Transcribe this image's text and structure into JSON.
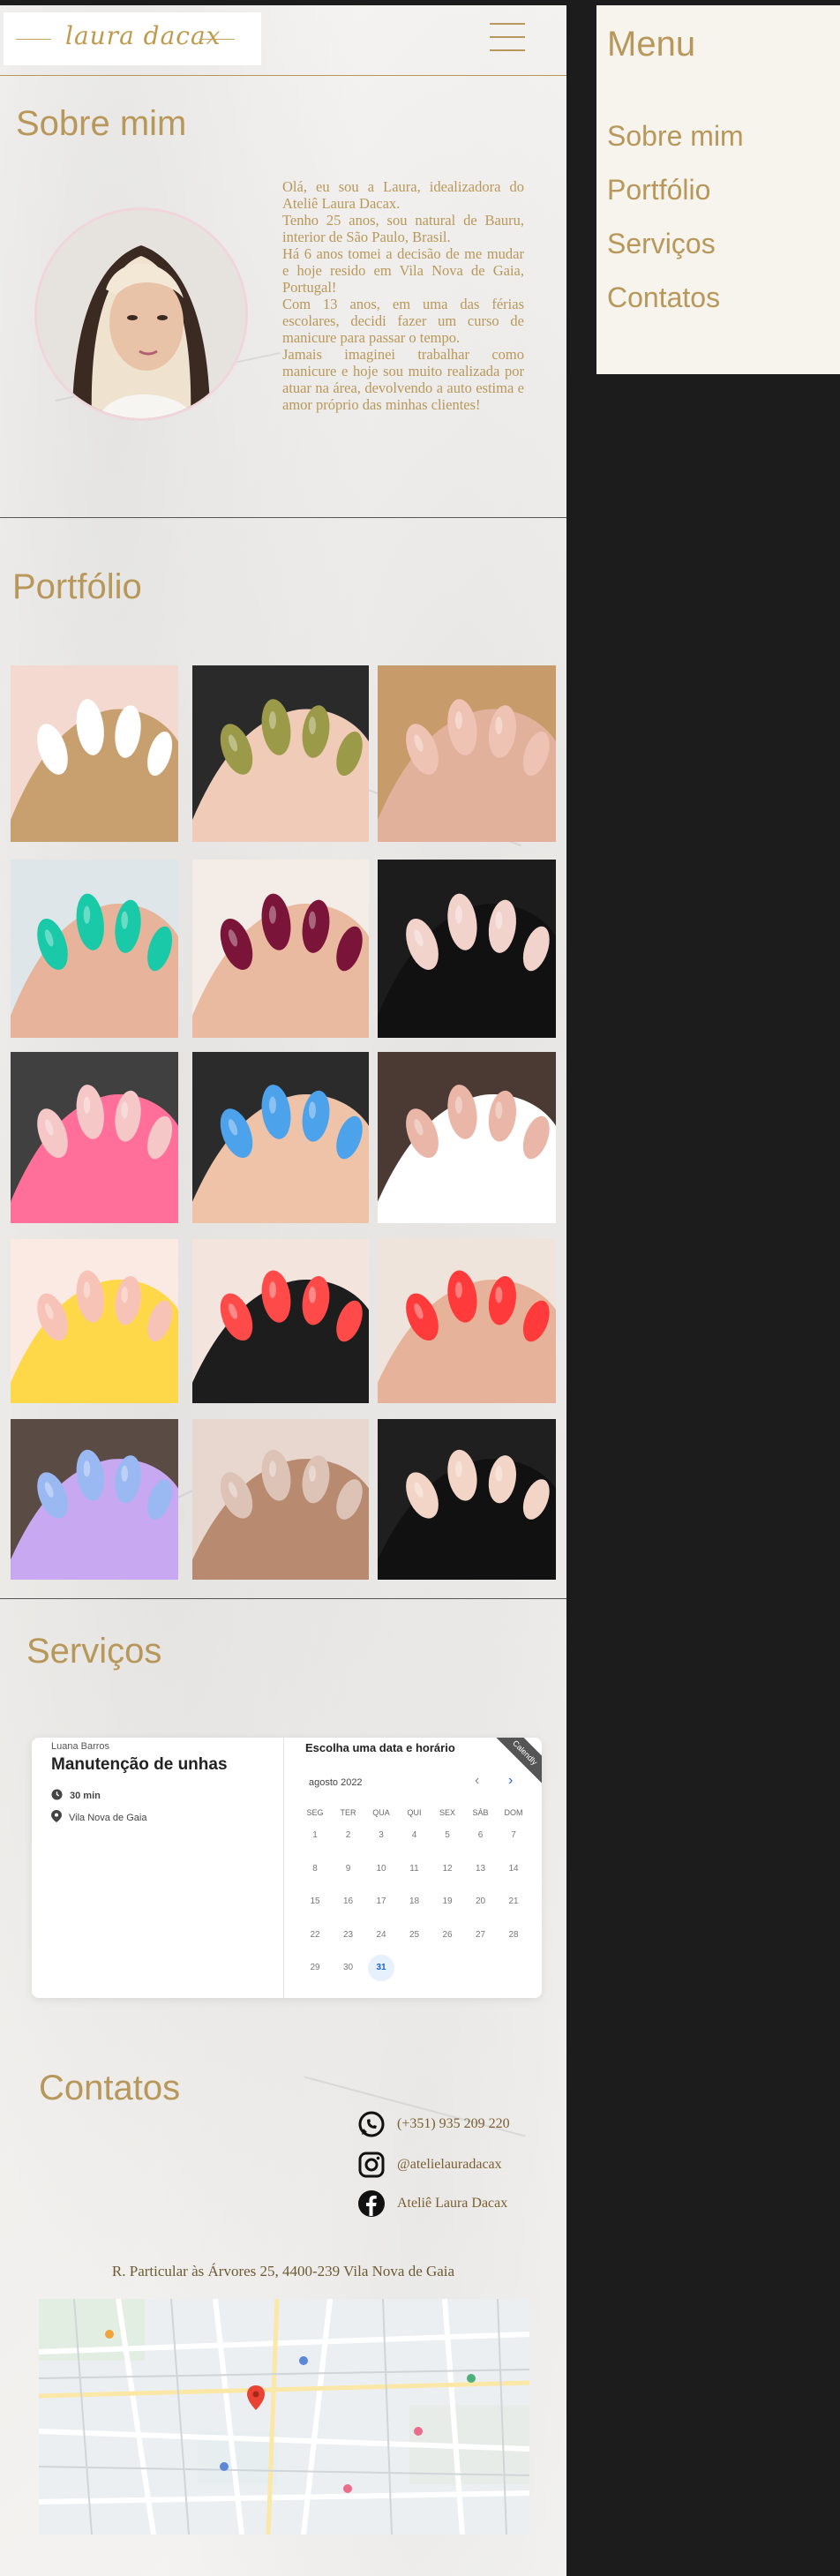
{
  "brand": {
    "logo_text": "laura dacax"
  },
  "about": {
    "title": "Sobre mim",
    "paragraphs": [
      "Olá, eu sou a Laura, idealizadora do Ateliê Laura Dacax.",
      "Tenho 25 anos, sou natural de Bauru, interior de São Paulo, Brasil.",
      "Há 6 anos tomei a decisão de me mudar e hoje resido em Vila Nova de Gaia, Portugal!",
      "Com 13 anos, em uma das férias escolares, decidi fazer um curso de manicure para passar o tempo.",
      "Jamais imaginei trabalhar como manicure e hoje sou muito realizada por atuar na área, devolvendo a auto estima e amor próprio das minhas clientes!"
    ]
  },
  "portfolio": {
    "title": "Portfólio",
    "tiles": [
      {
        "name": "french-white",
        "colors": [
          "#f3d9cf",
          "#ffffff",
          "#c8a070"
        ]
      },
      {
        "name": "olive-polish",
        "colors": [
          "#2a2a2a",
          "#9a9a48",
          "#f0ccb8"
        ]
      },
      {
        "name": "nude-almond",
        "colors": [
          "#c79b6a",
          "#efc3b3",
          "#e2b19c"
        ]
      },
      {
        "name": "turquoise",
        "colors": [
          "#dfe6ea",
          "#19c9a8",
          "#e7b39a"
        ]
      },
      {
        "name": "burgundy",
        "colors": [
          "#f4ece6",
          "#7a1438",
          "#e9b9a0"
        ]
      },
      {
        "name": "black-geometric",
        "colors": [
          "#1c1c1c",
          "#f1d3cc",
          "#111111"
        ]
      },
      {
        "name": "pink-french",
        "colors": [
          "#404040",
          "#f5c7c7",
          "#ff6f9a"
        ]
      },
      {
        "name": "blue-almond",
        "colors": [
          "#2b2b2b",
          "#4da2ec",
          "#efc3a8"
        ]
      },
      {
        "name": "white-lines",
        "colors": [
          "#4a3a33",
          "#e9b6a8",
          "#ffffff"
        ]
      },
      {
        "name": "colorful-tips",
        "colors": [
          "#fbe9e3",
          "#f6c3b6",
          "#ffd84a"
        ]
      },
      {
        "name": "red-art",
        "colors": [
          "#f3e4de",
          "#ff4a4a",
          "#1d1d1d"
        ]
      },
      {
        "name": "red-square",
        "colors": [
          "#efe4dc",
          "#ff3a3a",
          "#e7b29a"
        ]
      },
      {
        "name": "pastel-stiletto",
        "colors": [
          "#5a4b45",
          "#9ab9f2",
          "#c8a8f0"
        ]
      },
      {
        "name": "nude-glitter",
        "colors": [
          "#e8d7ce",
          "#dcc3b6",
          "#b88a70"
        ]
      },
      {
        "name": "black-nude",
        "colors": [
          "#1f1f1f",
          "#f2d5c6",
          "#111111"
        ]
      }
    ]
  },
  "services": {
    "title": "Serviços",
    "booking": {
      "owner": "Luana Barros",
      "service": "Manutenção de unhas",
      "duration": "30 min",
      "location": "Vila Nova de Gaia",
      "right_title": "Escolha uma data e horário",
      "month": "agosto 2022",
      "ribbon": "Calendly",
      "weekdays": [
        "SEG",
        "TER",
        "QUA",
        "QUI",
        "SEX",
        "SÁB",
        "DOM"
      ],
      "weeks": [
        [
          "1",
          "2",
          "3",
          "4",
          "5",
          "6",
          "7"
        ],
        [
          "8",
          "9",
          "10",
          "11",
          "12",
          "13",
          "14"
        ],
        [
          "15",
          "16",
          "17",
          "18",
          "19",
          "20",
          "21"
        ],
        [
          "22",
          "23",
          "24",
          "25",
          "26",
          "27",
          "28"
        ],
        [
          "29",
          "30",
          "31",
          "",
          "",
          "",
          ""
        ]
      ],
      "selected_day": "31"
    }
  },
  "contacts": {
    "title": "Contatos",
    "phone": "(+351) 935 209 220",
    "instagram": "@atelielauradacax",
    "facebook": "Ateliê Laura Dacax",
    "address": "R. Particular às Árvores 25, 4400-239 Vila Nova de Gaia"
  },
  "menu": {
    "title": "Menu",
    "items": [
      "Sobre mim",
      "Portfólio",
      "Serviços",
      "Contatos"
    ]
  },
  "colors": {
    "gold": "#b8985a",
    "background": "#1c1c1c",
    "page": "#f4f2ef"
  }
}
